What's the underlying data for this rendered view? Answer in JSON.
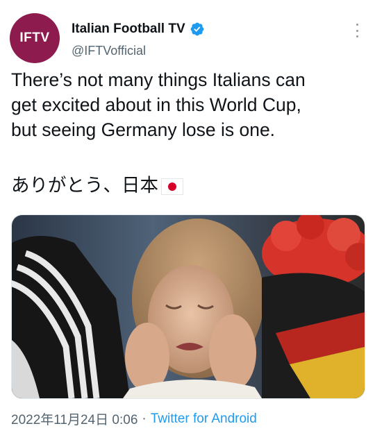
{
  "account": {
    "avatar_text": "IFTV",
    "display_name": "Italian Football TV",
    "handle": "@IFTVofficial",
    "verified": true,
    "brand_color": "#8e1b4d",
    "verified_color": "#1d9bf0"
  },
  "tweet": {
    "text": "There’s not many things Italians can\nget excited about in this World Cup,\nbut seeing Germany lose is one.",
    "text_jp": "ありがとう、日本",
    "flag_icon": "japan-flag-icon"
  },
  "meta": {
    "timestamp": "2022年11月24日 0:06",
    "separator": "·",
    "source": "Twitter for Android"
  },
  "icons": {
    "more": "more-options-icon",
    "verified": "verified-badge-icon"
  }
}
